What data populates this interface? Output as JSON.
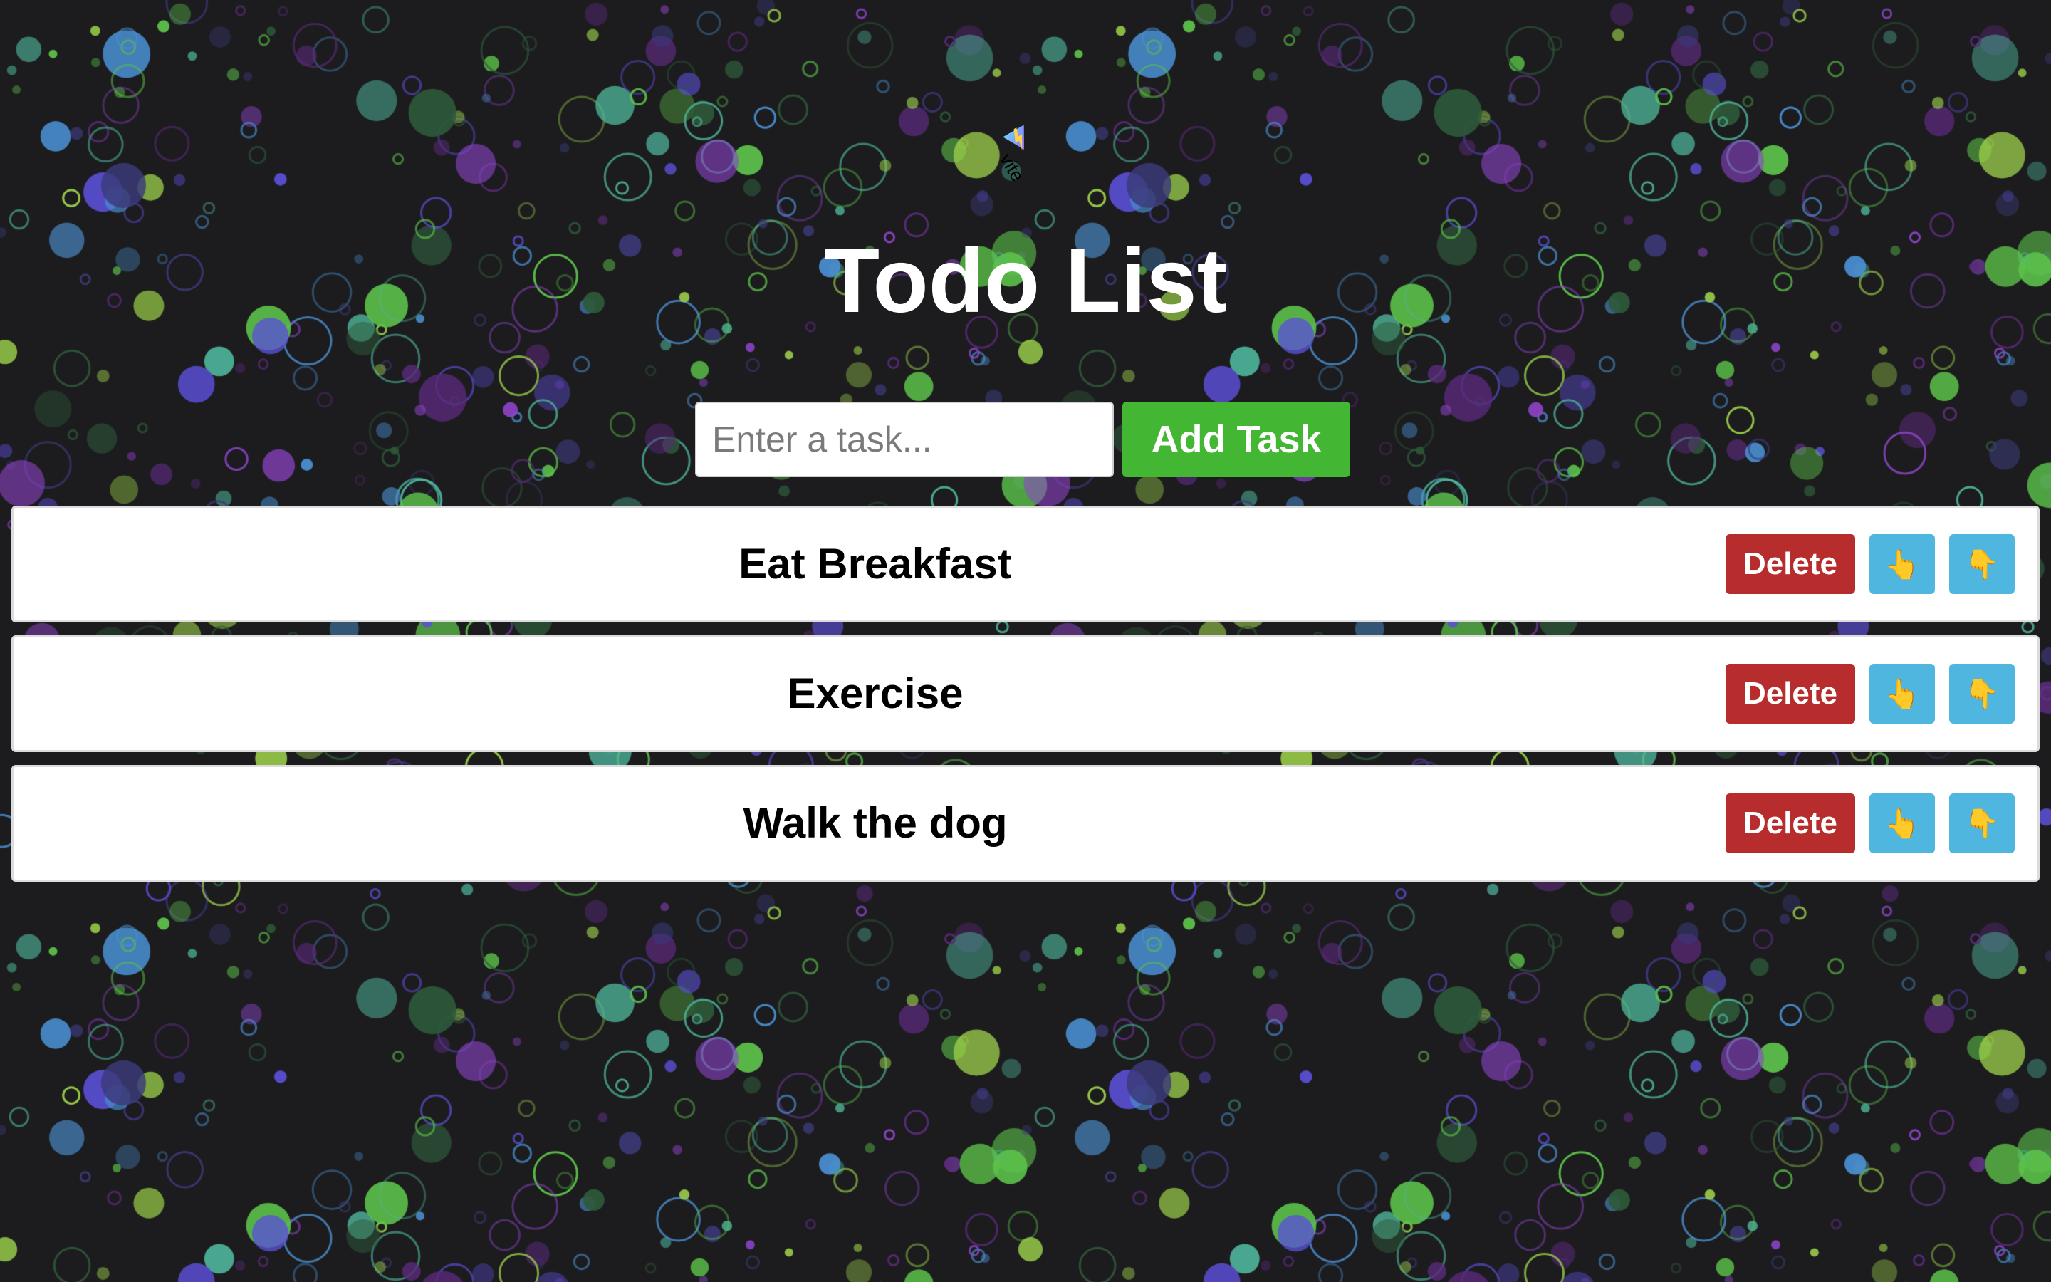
{
  "header": {
    "logo_alt": "vite",
    "title": "Todo List"
  },
  "add_form": {
    "placeholder": "Enter a task...",
    "value": "",
    "add_label": "Add Task"
  },
  "tasks": [
    {
      "text": "Eat Breakfast",
      "delete_label": "Delete",
      "up_glyph": "👆",
      "down_glyph": "👇"
    },
    {
      "text": "Exercise",
      "delete_label": "Delete",
      "up_glyph": "👆",
      "down_glyph": "👇"
    },
    {
      "text": "Walk the dog",
      "delete_label": "Delete",
      "up_glyph": "👆",
      "down_glyph": "👇"
    }
  ],
  "icons": {
    "logo": "vite-logo-icon",
    "move_up": "pointing-up-icon",
    "move_down": "pointing-down-icon"
  },
  "colors": {
    "background": "#1c1c1e",
    "add_button": "#43b733",
    "delete_button": "#b72c2c",
    "move_button": "#4fb6e0",
    "bubble_palette": [
      "#8e44c9",
      "#5b4fd6",
      "#4a8fd0",
      "#4fb89e",
      "#5cc24a",
      "#9bcf4a",
      "#3c3a7a",
      "#5a2a7a",
      "#2e5a3a"
    ]
  }
}
